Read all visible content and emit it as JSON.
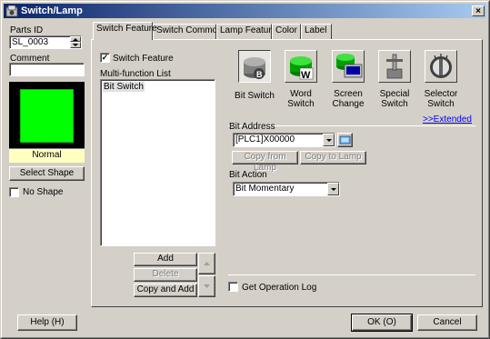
{
  "window": {
    "title": "Switch/Lamp",
    "close_label": "×"
  },
  "left": {
    "parts_id_label": "Parts ID",
    "parts_id_value": "SL_0003",
    "comment_label": "Comment",
    "comment_value": "",
    "preview_color": "#00ff00",
    "state_label": "Normal",
    "select_shape_label": "Select Shape",
    "no_shape_label": "No Shape",
    "no_shape_checked": false
  },
  "tabs": [
    {
      "label": "Switch Feature",
      "active": true
    },
    {
      "label": "Switch Common",
      "active": false
    },
    {
      "label": "Lamp Feature",
      "active": false
    },
    {
      "label": "Color",
      "active": false
    },
    {
      "label": "Label",
      "active": false
    }
  ],
  "switch_feature": {
    "checkbox_label": "Switch Feature",
    "checked": true,
    "list_label": "Multi-function List",
    "list_items": [
      "Bit Switch"
    ],
    "add_label": "Add",
    "delete_label": "Delete",
    "copy_add_label": "Copy and Add"
  },
  "features": [
    {
      "label_1": "Bit Switch",
      "label_2": "",
      "icon": "bit-switch-icon",
      "selected": true
    },
    {
      "label_1": "Word",
      "label_2": "Switch",
      "icon": "word-switch-icon",
      "selected": false
    },
    {
      "label_1": "Screen",
      "label_2": "Change",
      "icon": "screen-change-icon",
      "selected": false
    },
    {
      "label_1": "Special",
      "label_2": "Switch",
      "icon": "special-switch-icon",
      "selected": false
    },
    {
      "label_1": "Selector",
      "label_2": "Switch",
      "icon": "selector-switch-icon",
      "selected": false
    }
  ],
  "extended_label": ">>Extended",
  "bit_address": {
    "label": "Bit Address",
    "value": "[PLC1]X00000",
    "copy_from_lamp": "Copy from Lamp",
    "copy_to_lamp": "Copy to Lamp"
  },
  "bit_action": {
    "label": "Bit Action",
    "value": "Bit Momentary"
  },
  "log": {
    "label": "Get Operation Log",
    "checked": false
  },
  "footer": {
    "help_label": "Help (H)",
    "ok_label": "OK (O)",
    "cancel_label": "Cancel"
  }
}
